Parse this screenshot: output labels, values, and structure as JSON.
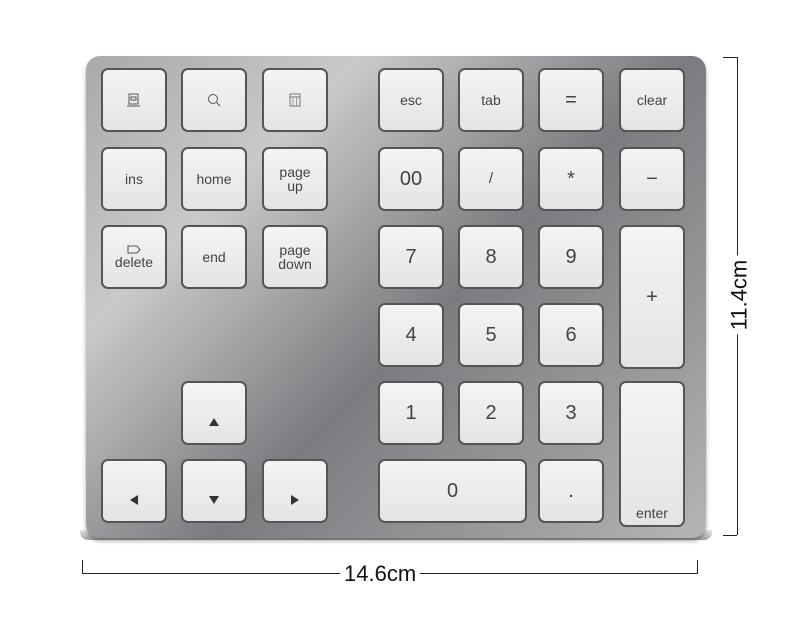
{
  "keys": {
    "function_icons": [
      {
        "icon": "app-window-icon"
      },
      {
        "icon": "search-icon"
      },
      {
        "icon": "calculator-icon"
      }
    ],
    "esc": "esc",
    "tab": "tab",
    "equals": "=",
    "clear": "clear",
    "ins": "ins",
    "home": "home",
    "page_up": [
      "page",
      "up"
    ],
    "double_zero": "00",
    "slash": "/",
    "asterisk": "*",
    "minus": "−",
    "delete": "delete",
    "end": "end",
    "page_down": [
      "page",
      "down"
    ],
    "seven": "7",
    "eight": "8",
    "nine": "9",
    "plus": "+",
    "four": "4",
    "five": "5",
    "six": "6",
    "one": "1",
    "two": "2",
    "three": "3",
    "zero": "0",
    "dot": ".",
    "enter": "enter",
    "arrows": [
      "arrow-up-icon",
      "arrow-left-icon",
      "arrow-down-icon",
      "arrow-right-icon"
    ]
  },
  "dimensions": {
    "width": "14.6cm",
    "height": "11.4cm"
  }
}
